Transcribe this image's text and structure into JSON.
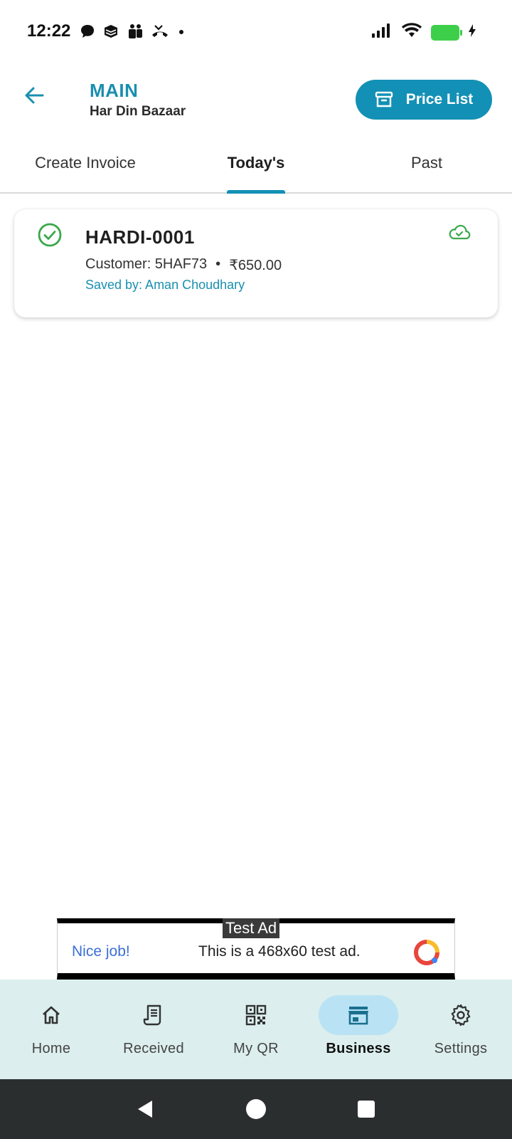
{
  "status_bar": {
    "time": "12:22",
    "left_icons": [
      "chat-icon",
      "app-icon",
      "teams-icon",
      "missed-call-icon",
      "dot-icon"
    ],
    "right_icons": [
      "signal-icon",
      "wifi-icon",
      "battery-charging-icon"
    ],
    "battery_color": "#3ecf4a"
  },
  "header": {
    "title": "MAIN",
    "subtitle": "Har Din Bazaar",
    "price_list_label": "Price List",
    "accent_color": "#1390b5"
  },
  "tabs": [
    {
      "label": "Create Invoice",
      "active": false
    },
    {
      "label": "Today's",
      "active": true
    },
    {
      "label": "Past",
      "active": false
    }
  ],
  "invoice": {
    "number": "HARDI-0001",
    "customer": "Customer: 5HAF73",
    "separator": "•",
    "amount": "₹650.00",
    "saved_by": "Saved by: Aman Choudhary",
    "status": "synced"
  },
  "ad": {
    "badge": "Test Ad",
    "left_text": "Nice job!",
    "text": "This is a 468x60 test ad."
  },
  "bottom_nav": [
    {
      "label": "Home",
      "icon": "home-icon",
      "active": false
    },
    {
      "label": "Received",
      "icon": "receipt-icon",
      "active": false
    },
    {
      "label": "My QR",
      "icon": "qr-icon",
      "active": false
    },
    {
      "label": "Business",
      "icon": "store-icon",
      "active": true
    },
    {
      "label": "Settings",
      "icon": "gear-icon",
      "active": false
    }
  ]
}
